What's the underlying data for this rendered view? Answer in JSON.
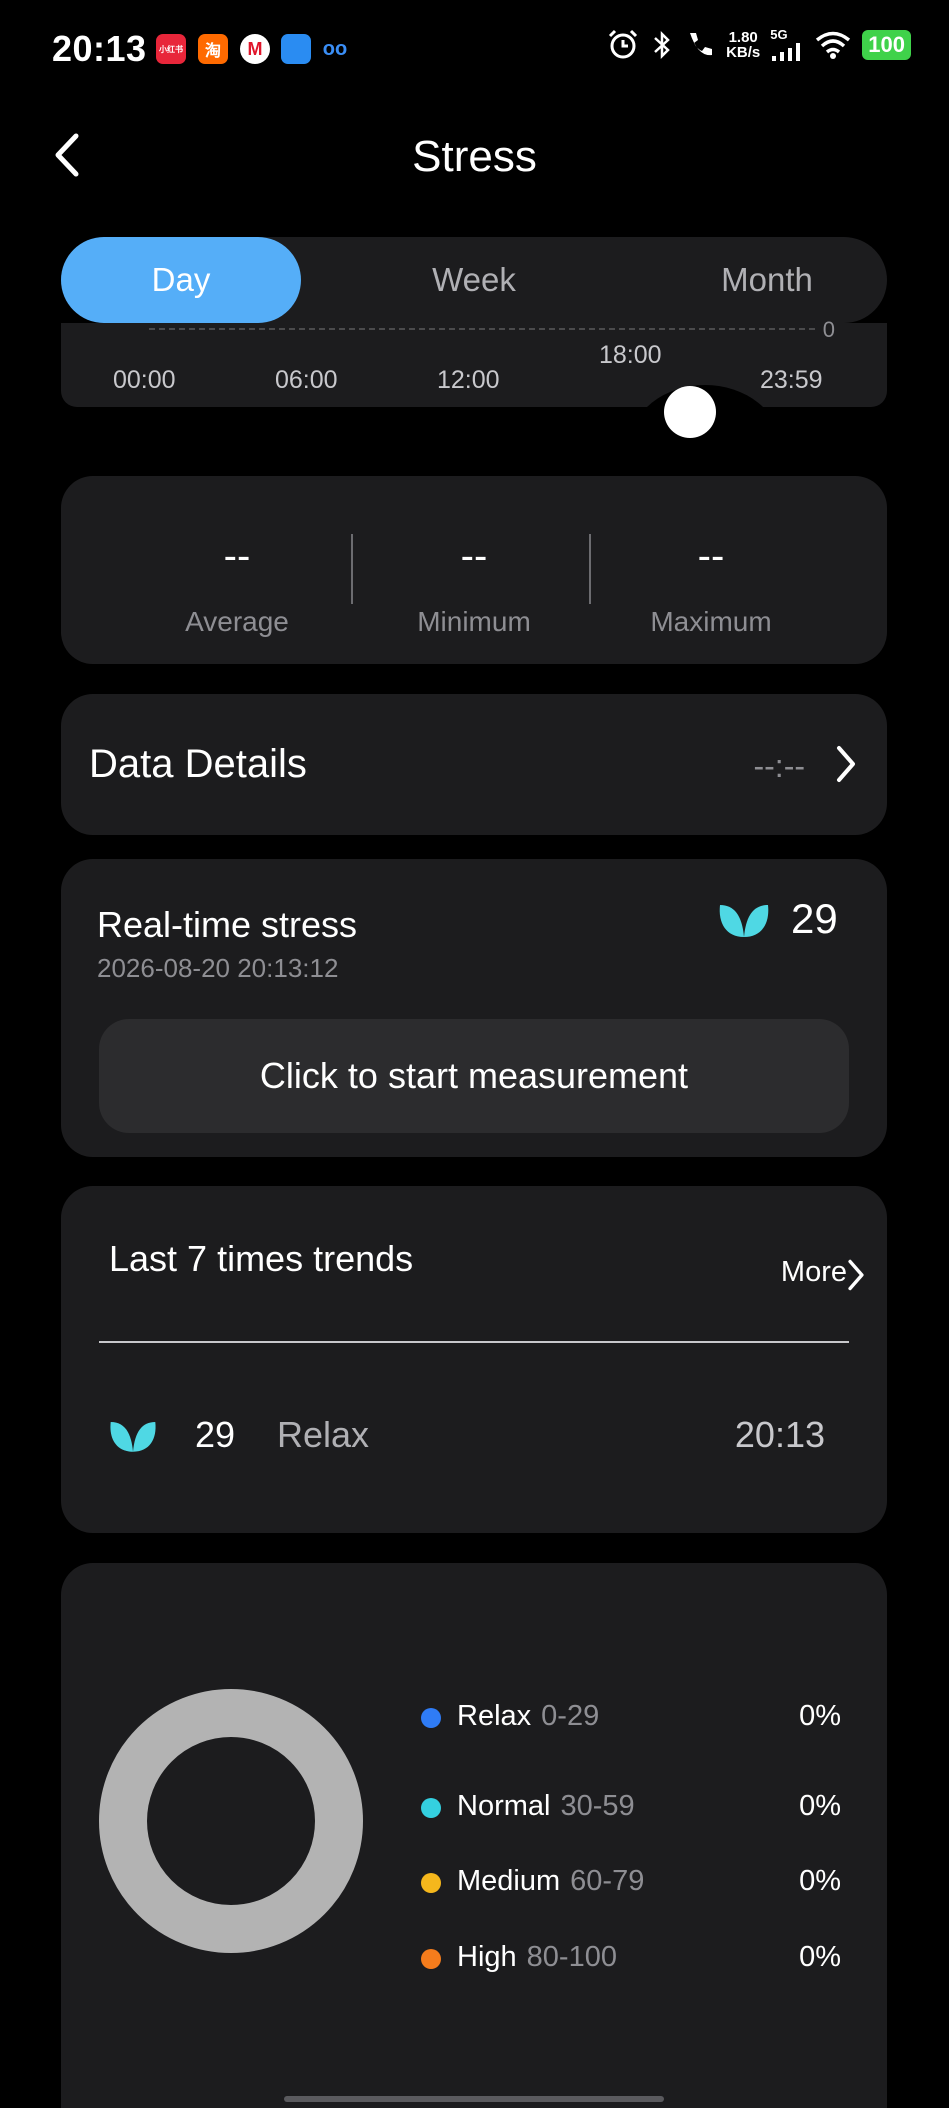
{
  "status_bar": {
    "time": "20:13",
    "apps": [
      "小红书",
      "淘",
      "M",
      "",
      "oo"
    ],
    "net_speed_value": "1.80",
    "net_speed_unit": "KB/s",
    "network": "5G",
    "battery": "100"
  },
  "header": {
    "title": "Stress"
  },
  "tabs": [
    {
      "label": "Day",
      "active": true
    },
    {
      "label": "Week",
      "active": false
    },
    {
      "label": "Month",
      "active": false
    }
  ],
  "timeline": {
    "zero_label": "0",
    "ticks": [
      "00:00",
      "06:00",
      "12:00",
      "18:00",
      "23:59"
    ]
  },
  "summary": {
    "average": {
      "value": "--",
      "label": "Average"
    },
    "minimum": {
      "value": "--",
      "label": "Minimum"
    },
    "maximum": {
      "value": "--",
      "label": "Maximum"
    }
  },
  "data_details": {
    "label": "Data Details",
    "time": "--:--"
  },
  "realtime": {
    "title": "Real-time stress",
    "timestamp": "2026-08-20 20:13:12",
    "value": "29",
    "button_label": "Click to start measurement"
  },
  "trends": {
    "title": "Last 7 times trends",
    "more_label": "More",
    "items": [
      {
        "value": "29",
        "status": "Relax",
        "time": "20:13"
      }
    ]
  },
  "distribution": {
    "ring_color": "#b3b3b3",
    "legend": [
      {
        "name": "Relax",
        "range": "0-29",
        "percent": "0%",
        "color": "#2f7cf6"
      },
      {
        "name": "Normal",
        "range": "30-59",
        "percent": "0%",
        "color": "#34d0e0"
      },
      {
        "name": "Medium",
        "range": "60-79",
        "percent": "0%",
        "color": "#f5b71c"
      },
      {
        "name": "High",
        "range": "80-100",
        "percent": "0%",
        "color": "#f57c1c"
      }
    ]
  },
  "colors": {
    "accent": "#55aef8",
    "card_bg": "#1c1c1e",
    "leaf": "#4fd8e4"
  }
}
